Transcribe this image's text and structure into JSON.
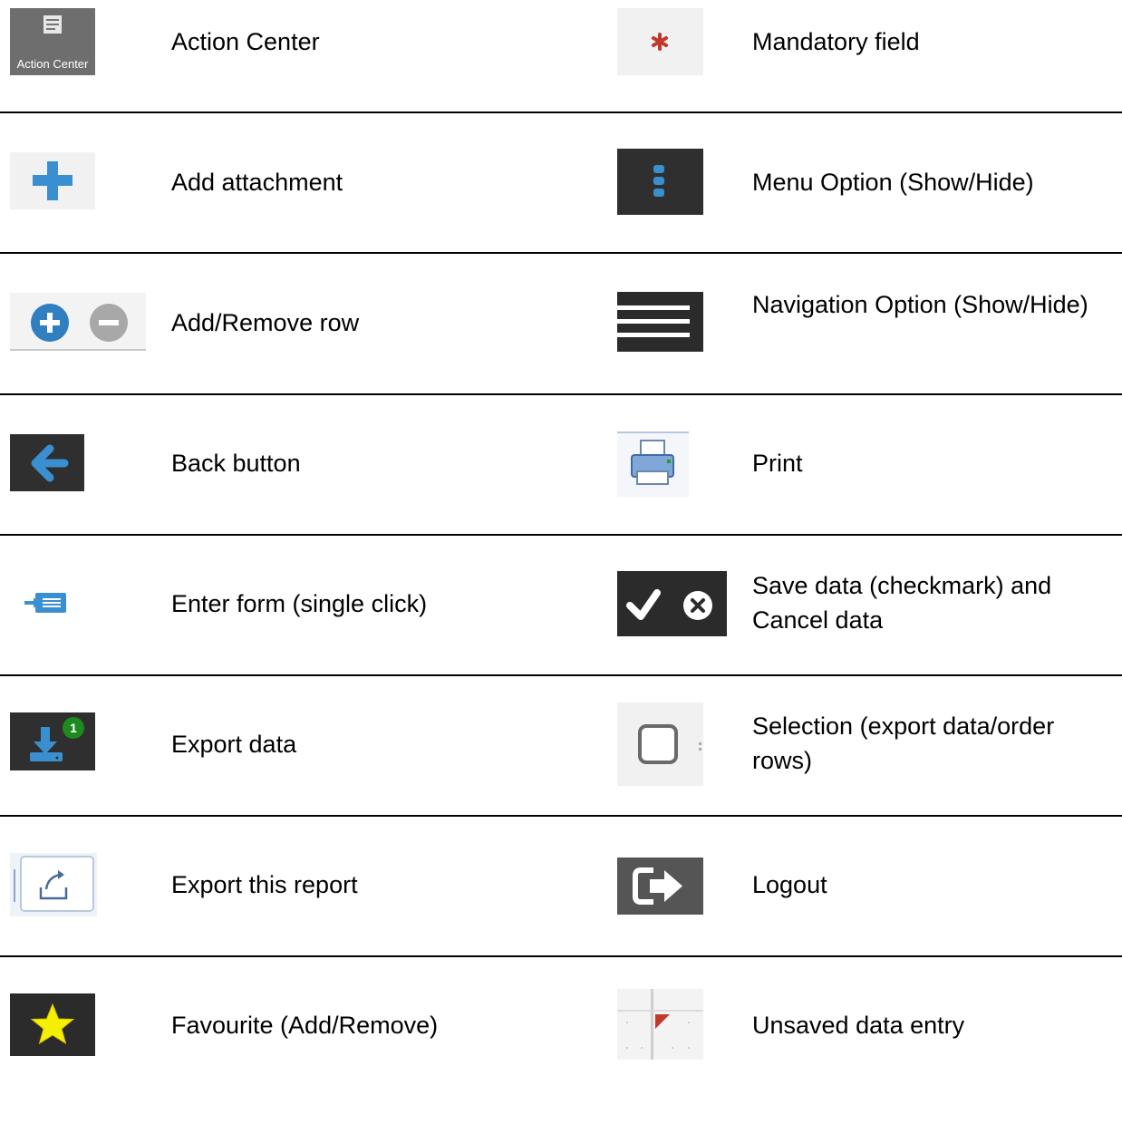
{
  "rows": [
    {
      "left": {
        "icon": "action-center-icon",
        "icon_text": "Action Center",
        "label": "Action Center"
      },
      "right": {
        "icon": "mandatory-asterisk-icon",
        "label": "Mandatory field"
      }
    },
    {
      "left": {
        "icon": "plus-icon",
        "label": "Add attachment"
      },
      "right": {
        "icon": "menu-dots-icon",
        "label": "Menu Option (Show/Hide)"
      }
    },
    {
      "left": {
        "icon": "add-remove-circle-icon",
        "label": "Add/Remove row"
      },
      "right": {
        "icon": "hamburger-icon",
        "label": "Navigation Option (Show/Hide)"
      }
    },
    {
      "left": {
        "icon": "back-arrow-icon",
        "label": "Back button"
      },
      "right": {
        "icon": "printer-icon",
        "label": "Print"
      }
    },
    {
      "left": {
        "icon": "enter-form-icon",
        "label": "Enter form (single click)"
      },
      "right": {
        "icon": "check-cancel-icon",
        "label": "Save data (checkmark) and Cancel data"
      }
    },
    {
      "left": {
        "icon": "export-download-icon",
        "badge": "1",
        "label": "Export data"
      },
      "right": {
        "icon": "checkbox-icon",
        "label": "Selection (export data/order rows)"
      }
    },
    {
      "left": {
        "icon": "export-report-icon",
        "label": "Export this report"
      },
      "right": {
        "icon": "logout-icon",
        "label": "Logout"
      }
    },
    {
      "left": {
        "icon": "star-icon",
        "label": "Favourite (Add/Remove)"
      },
      "right": {
        "icon": "unsaved-flag-icon",
        "label": "Unsaved data entry"
      }
    }
  ],
  "colors": {
    "dark_tile": "#2f2f2f",
    "blue": "#3a8fd0",
    "yellow": "#f5f000",
    "red": "#c0392b",
    "green": "#1e8a1e"
  }
}
